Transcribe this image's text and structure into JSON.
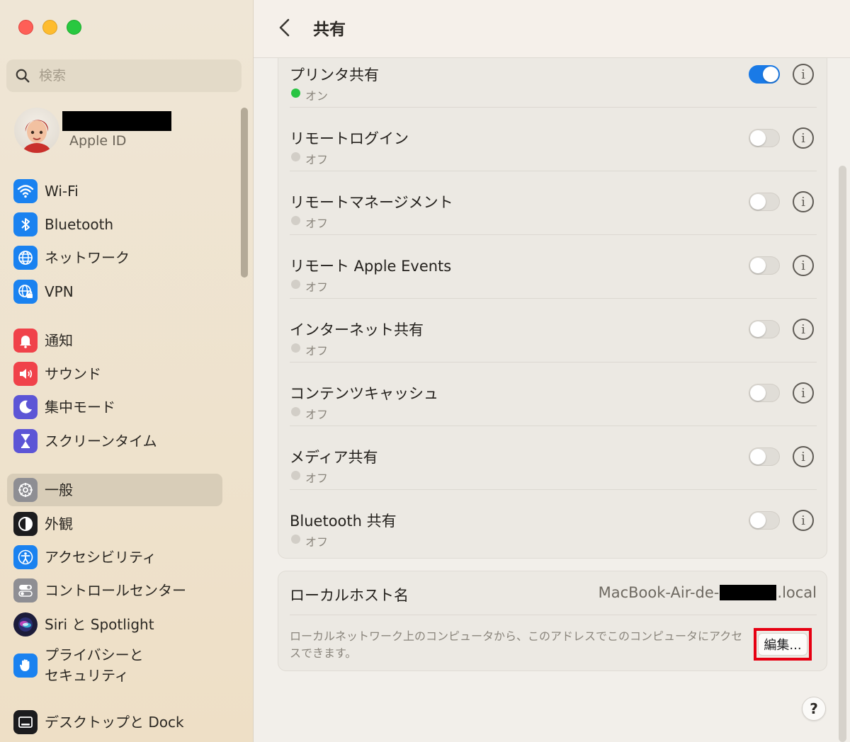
{
  "window": {
    "traffic_lights": [
      "close",
      "minimize",
      "zoom"
    ]
  },
  "search": {
    "placeholder": "検索"
  },
  "account": {
    "subtitle": "Apple ID"
  },
  "sidebar": {
    "items": [
      {
        "label": "Wi-Fi",
        "icon": "wifi-icon",
        "color": "#1a82f0"
      },
      {
        "label": "Bluetooth",
        "icon": "bluetooth-icon",
        "color": "#1a82f0"
      },
      {
        "label": "ネットワーク",
        "icon": "globe-icon",
        "color": "#1a82f0"
      },
      {
        "label": "VPN",
        "icon": "vpn-globe-icon",
        "color": "#1a82f0"
      },
      {
        "label": "通知",
        "icon": "bell-icon",
        "color": "#f0424a"
      },
      {
        "label": "サウンド",
        "icon": "speaker-icon",
        "color": "#f0424a"
      },
      {
        "label": "集中モード",
        "icon": "moon-icon",
        "color": "#5c55d6"
      },
      {
        "label": "スクリーンタイム",
        "icon": "hourglass-icon",
        "color": "#5c55d6"
      },
      {
        "label": "一般",
        "icon": "gear-icon",
        "color": "#8e8e93",
        "selected": true
      },
      {
        "label": "外観",
        "icon": "appearance-icon",
        "color": "#1c1c1e"
      },
      {
        "label": "アクセシビリティ",
        "icon": "accessibility-icon",
        "color": "#1a82f0"
      },
      {
        "label": "コントロールセンター",
        "icon": "control-center-icon",
        "color": "#8e8e93"
      },
      {
        "label": "Siri と Spotlight",
        "icon": "siri-icon",
        "color": "#3b3b9a"
      },
      {
        "label_line1": "プライバシーと",
        "label_line2": "セキュリティ",
        "icon": "hand-icon",
        "color": "#1a82f0"
      },
      {
        "label": "デスクトップと Dock",
        "icon": "dock-icon",
        "color": "#1c1c1e"
      }
    ]
  },
  "header": {
    "title": "共有"
  },
  "services": [
    {
      "name": "プリンタ共有",
      "status": "オン",
      "enabled": true
    },
    {
      "name": "リモートログイン",
      "status": "オフ",
      "enabled": false
    },
    {
      "name": "リモートマネージメント",
      "status": "オフ",
      "enabled": false
    },
    {
      "name": "リモート Apple Events",
      "status": "オフ",
      "enabled": false
    },
    {
      "name": "インターネット共有",
      "status": "オフ",
      "enabled": false
    },
    {
      "name": "コンテンツキャッシュ",
      "status": "オフ",
      "enabled": false
    },
    {
      "name": "メディア共有",
      "status": "オフ",
      "enabled": false
    },
    {
      "name": "Bluetooth 共有",
      "status": "オフ",
      "enabled": false
    }
  ],
  "info_glyph": "i",
  "local_hostname": {
    "label": "ローカルホスト名",
    "value_prefix": "MacBook-Air-de-",
    "value_suffix": ".local",
    "description": "ローカルネットワーク上のコンピュータから、このアドレスでこのコンピュータにアクセスできます。",
    "edit_label": "編集..."
  },
  "help_label": "?",
  "colors": {
    "accent": "#1a7ae6",
    "status_on": "#29c443",
    "highlight_box": "#e60012"
  }
}
